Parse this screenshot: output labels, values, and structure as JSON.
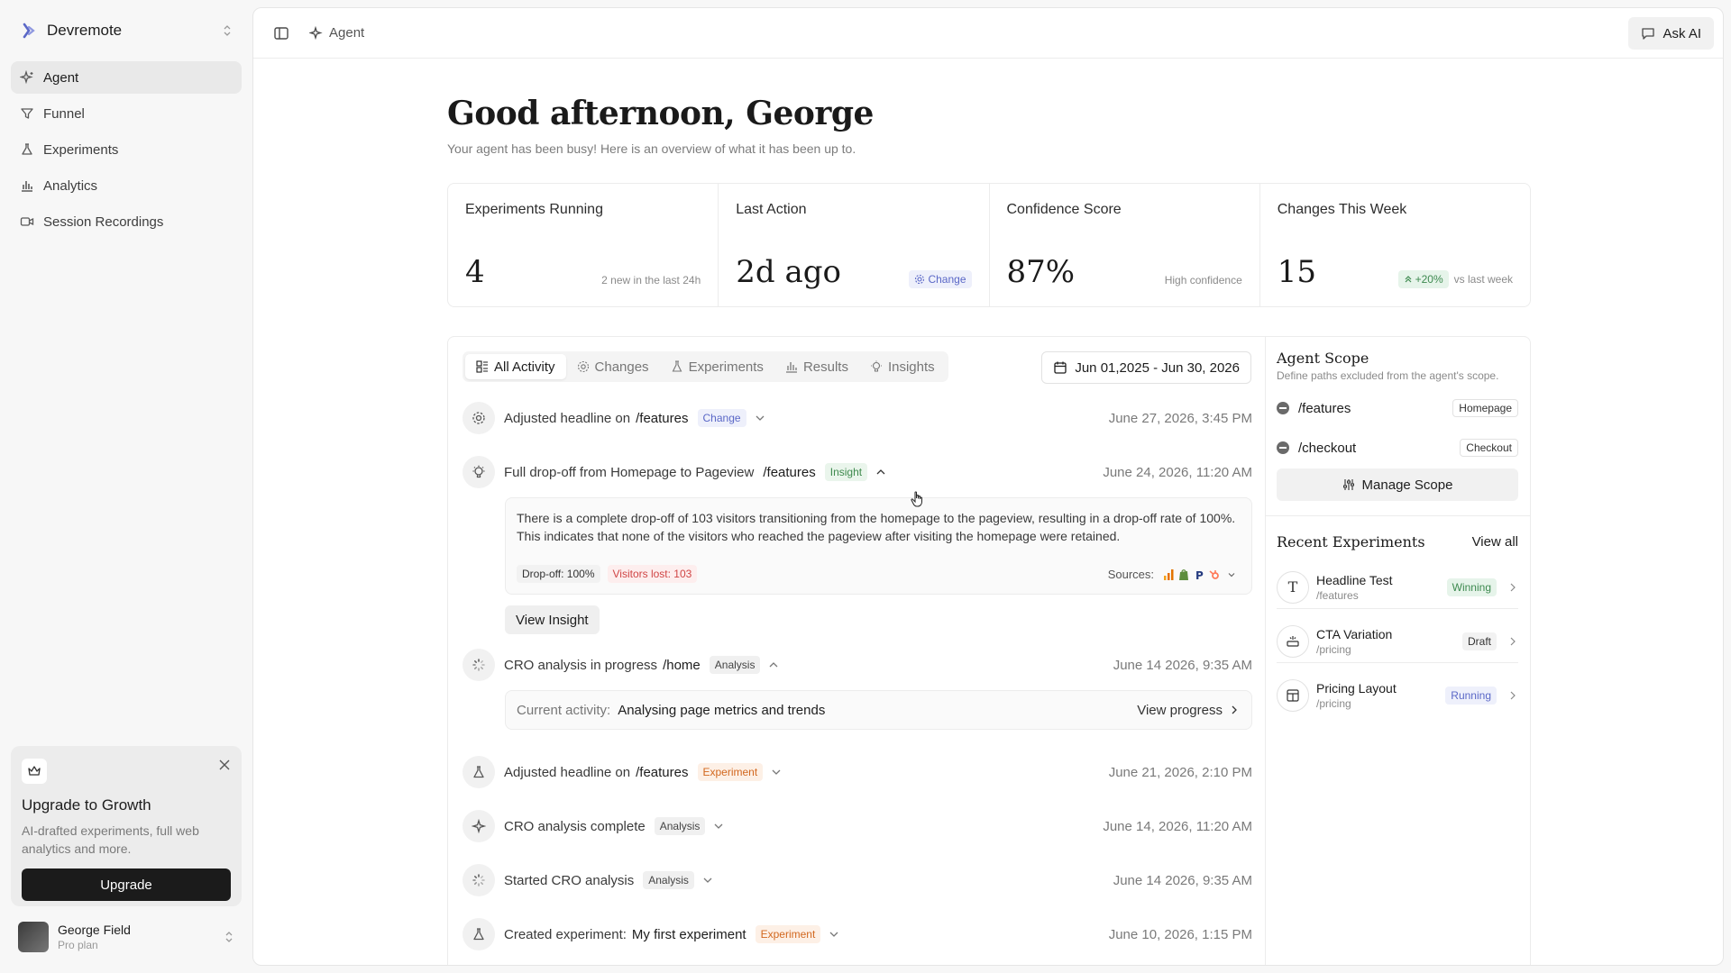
{
  "sidebar": {
    "brand": "Devremote",
    "items": [
      {
        "label": "Agent",
        "icon": "sparkle-icon"
      },
      {
        "label": "Funnel",
        "icon": "funnel-icon"
      },
      {
        "label": "Experiments",
        "icon": "flask-icon"
      },
      {
        "label": "Analytics",
        "icon": "bar-chart-icon"
      },
      {
        "label": "Session Recordings",
        "icon": "video-icon"
      }
    ],
    "upgrade": {
      "title": "Upgrade to Growth",
      "text": "AI-drafted experiments, full web analytics and more.",
      "button": "Upgrade"
    },
    "user": {
      "name": "George Field",
      "plan": "Pro plan"
    }
  },
  "topbar": {
    "crumb": "Agent",
    "ask_ai": "Ask AI"
  },
  "header": {
    "greeting": "Good afternoon, George",
    "subtitle": "Your agent has been busy! Here is an overview of what it has been up to."
  },
  "stats": [
    {
      "label": "Experiments Running",
      "value": "4",
      "note": "2 new in the last 24h"
    },
    {
      "label": "Last Action",
      "value": "2d ago",
      "badge": "Change"
    },
    {
      "label": "Confidence Score",
      "value": "87%",
      "note": "High confidence"
    },
    {
      "label": "Changes This Week",
      "value": "15",
      "badge": "+20%",
      "note": "vs last week"
    }
  ],
  "tabs": [
    "All Activity",
    "Changes",
    "Experiments",
    "Results",
    "Insights"
  ],
  "date_range": "Jun 01,2025 - Jun 30, 2026",
  "activity": [
    {
      "text": "Adjusted headline on",
      "path": "/features",
      "tag": "Change",
      "date": "June 27, 2026, 3:45 PM"
    },
    {
      "text": "Full drop-off from Homepage to Pageview",
      "path": "/features",
      "tag": "Insight",
      "date": "June 24, 2026, 11:20 AM"
    },
    {
      "text": "CRO analysis in progress",
      "path": "/home",
      "tag": "Analysis",
      "date": "June 14 2026, 9:35 AM"
    },
    {
      "text": "Adjusted headline on",
      "path": "/features",
      "tag": "Experiment",
      "date": "June 21, 2026, 2:10 PM"
    },
    {
      "text": "CRO analysis complete",
      "path": "",
      "tag": "Analysis",
      "date": "June 14, 2026, 11:20 AM"
    },
    {
      "text": "Started CRO analysis",
      "path": "",
      "tag": "Analysis",
      "date": "June 14 2026, 9:35 AM"
    },
    {
      "text": "Created experiment:",
      "path": "My first experiment",
      "tag": "Experiment",
      "date": "June 10, 2026, 1:15 PM"
    }
  ],
  "insight_detail": {
    "text": "There is a complete drop-off of 103 visitors transitioning from the homepage to the pageview, resulting in a drop-off rate of 100%. This indicates that none of the visitors who reached the pageview after visiting the homepage were retained.",
    "tag1": "Drop-off: 100%",
    "tag2": "Visitors lost: 103",
    "sources_label": "Sources:",
    "view_button": "View Insight"
  },
  "current_activity": {
    "label": "Current activity:",
    "value": "Analysing page metrics and trends",
    "link": "View progress"
  },
  "scope": {
    "title": "Agent Scope",
    "desc": "Define paths excluded from the agent's scope.",
    "paths": [
      {
        "path": "/features",
        "tag": "Homepage"
      },
      {
        "path": "/checkout",
        "tag": "Checkout"
      }
    ],
    "manage": "Manage Scope"
  },
  "recent": {
    "title": "Recent Experiments",
    "view_all": "View all",
    "items": [
      {
        "title": "Headline Test",
        "path": "/features",
        "status": "Winning"
      },
      {
        "title": "CTA Variation",
        "path": "/pricing",
        "status": "Draft"
      },
      {
        "title": "Pricing Layout",
        "path": "/pricing",
        "status": "Running"
      }
    ]
  }
}
